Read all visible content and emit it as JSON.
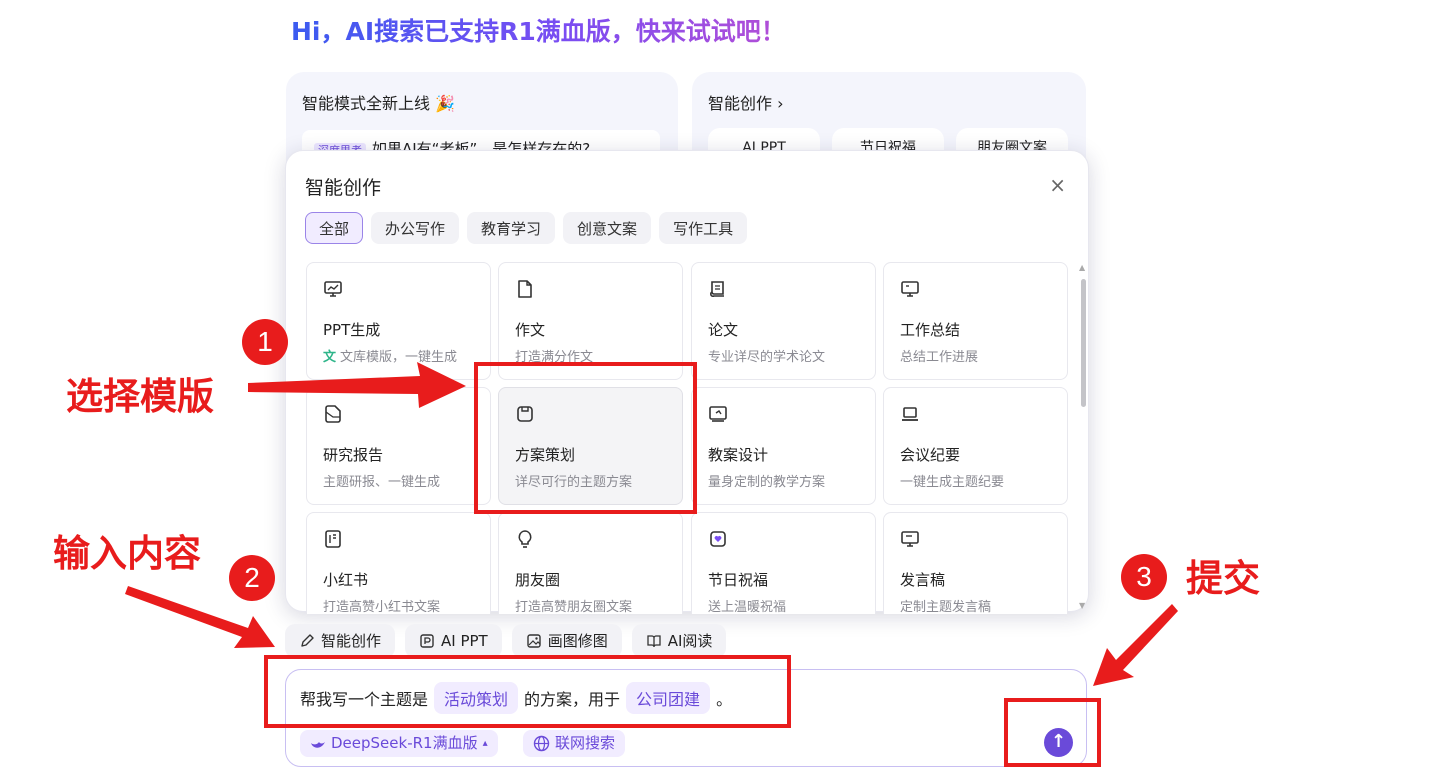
{
  "headline": "Hi，AI搜索已支持R1满血版，快来试试吧！",
  "bg_cards": {
    "left_title": "智能模式全新上线 🎉",
    "left_tag": "深度思考",
    "left_text": "如果AI有“老板”，是怎样存在的?",
    "right_title": "智能创作 ›",
    "right_pills": [
      "AI PPT",
      "节日祝福",
      "朋友圈文案"
    ]
  },
  "modal": {
    "title": "智能创作",
    "close": "×",
    "tabs": [
      "全部",
      "办公写作",
      "教育学习",
      "创意文案",
      "写作工具"
    ],
    "active_tab": "全部",
    "cards": [
      {
        "title": "PPT生成",
        "desc": "文库模版，一键生成",
        "icon": "presentation-icon",
        "wenku": "文"
      },
      {
        "title": "作文",
        "desc": "打造满分作文",
        "icon": "document-icon"
      },
      {
        "title": "论文",
        "desc": "专业详尽的学术论文",
        "icon": "scroll-icon"
      },
      {
        "title": "工作总结",
        "desc": "总结工作进展",
        "icon": "monitor-icon"
      },
      {
        "title": "研究报告",
        "desc": "主题研报、一键生成",
        "icon": "report-icon"
      },
      {
        "title": "方案策划",
        "desc": "详尽可行的主题方案",
        "icon": "plan-icon"
      },
      {
        "title": "教案设计",
        "desc": "量身定制的教学方案",
        "icon": "lesson-icon"
      },
      {
        "title": "会议纪要",
        "desc": "一键生成主题纪要",
        "icon": "laptop-icon"
      },
      {
        "title": "小红书",
        "desc": "打造高赞小红书文案",
        "icon": "notebook-icon"
      },
      {
        "title": "朋友圈",
        "desc": "打造高赞朋友圈文案",
        "icon": "lightbulb-icon"
      },
      {
        "title": "节日祝福",
        "desc": "送上温暖祝福",
        "icon": "heart-icon"
      },
      {
        "title": "发言稿",
        "desc": "定制主题发言稿",
        "icon": "speech-icon"
      }
    ]
  },
  "tools": [
    "智能创作",
    "AI PPT",
    "画图修图",
    "AI阅读"
  ],
  "input": {
    "prefix": "帮我写一个主题是",
    "slot1": "活动策划",
    "middle": "的方案，用于",
    "slot2": "公司团建",
    "suffix": "。",
    "model": "DeepSeek-R1满血版",
    "model_caret": "▴",
    "web_search": "联网搜索",
    "send": "↑"
  },
  "annotations": {
    "step1_num": "1",
    "step1_label": "选择模版",
    "step2_num": "2",
    "step2_label": "输入内容",
    "step3_num": "3",
    "step3_label": "提交",
    "color": "#e81c1c"
  }
}
